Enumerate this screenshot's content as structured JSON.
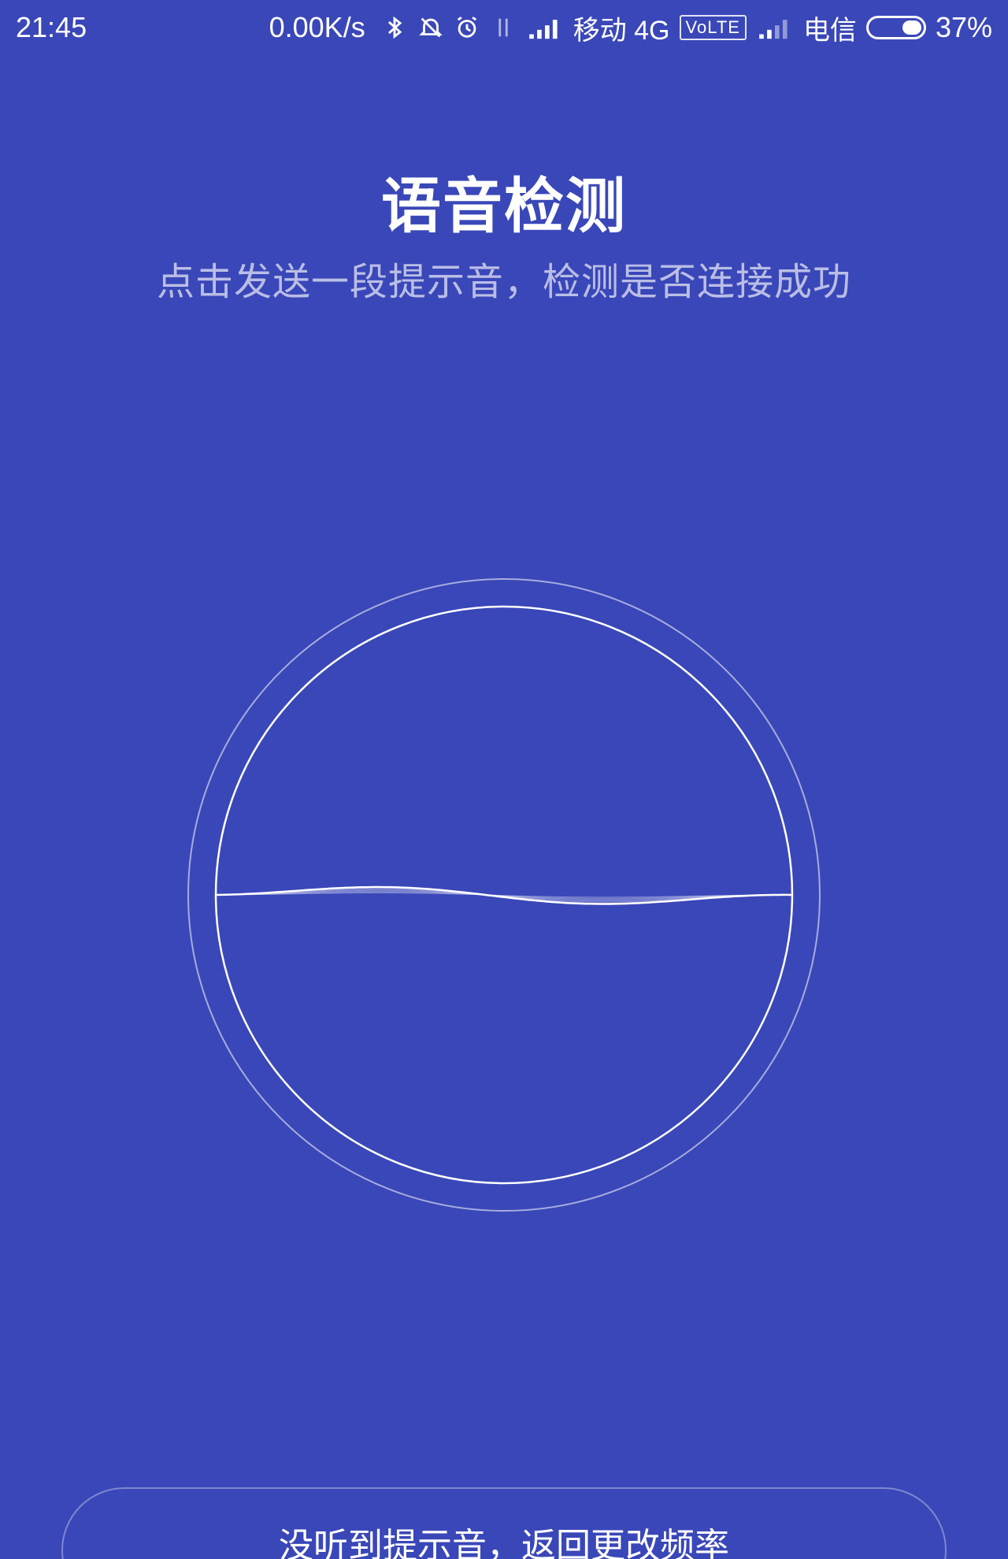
{
  "status_bar": {
    "time": "21:45",
    "speed": "0.00K/s",
    "carrier1": "移动 4G",
    "volte": "VoLTE",
    "carrier2": "电信",
    "battery_text": "37%",
    "battery_level": 0.37,
    "icons": [
      "bluetooth-icon",
      "mute-icon",
      "alarm-icon",
      "data-arrows-icon",
      "signal-icon"
    ]
  },
  "header": {
    "title": "语音检测",
    "subtitle": "点击发送一段提示音，检测是否连接成功"
  },
  "detect": {
    "icon": "sound-wave-icon",
    "accent": "#ffffff",
    "background": "#3a47b8"
  },
  "bottom": {
    "button_label": "没听到提示音，返回更改频率"
  }
}
